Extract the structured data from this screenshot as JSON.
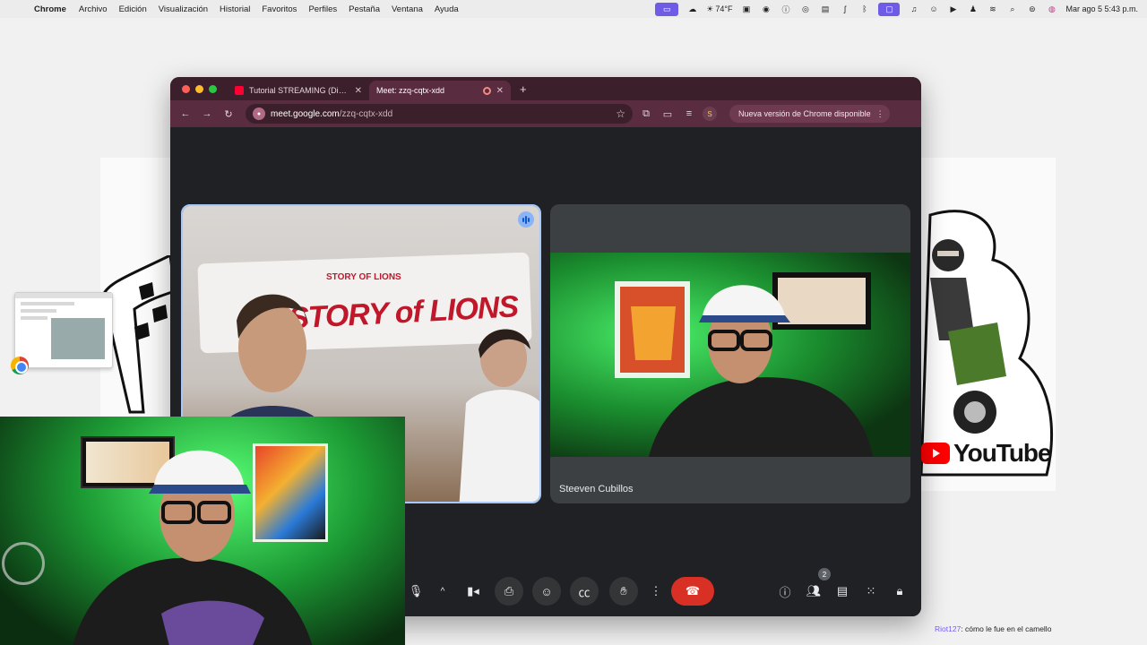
{
  "menubar": {
    "app_name": "Chrome",
    "items": [
      "Archivo",
      "Edición",
      "Visualización",
      "Historial",
      "Favoritos",
      "Perfiles",
      "Pestaña",
      "Ventana",
      "Ayuda"
    ],
    "weather": "74°F",
    "datetime": "Mar ago 5  5:43 p.m."
  },
  "browser": {
    "tabs": [
      {
        "title": "Tutorial STREAMING (Director",
        "icon": "youtube-icon"
      },
      {
        "title": "Meet: zzq-cqtx-xdd",
        "icon": "meet-icon"
      }
    ],
    "url": {
      "host": "meet.google.com",
      "path": "/zzq-cqtx-xdd"
    },
    "profile_initial": "S",
    "update_label": "Nueva versión de Chrome disponible"
  },
  "meet": {
    "tiles": [
      {
        "name": "",
        "banner": "STORY of LIONS",
        "banner_small": "STORY OF LIONS",
        "speaking": true
      },
      {
        "name": "Steeven Cubillos"
      }
    ],
    "participant_count": "2",
    "colors": {
      "hangup": "#d93025",
      "speaking": "#8ab4f8",
      "background": "#202124"
    }
  },
  "desktop": {
    "youtube_word": "YouTube"
  },
  "chat": {
    "user": "Riot127",
    "message": ": cómo le fue en el camello"
  }
}
